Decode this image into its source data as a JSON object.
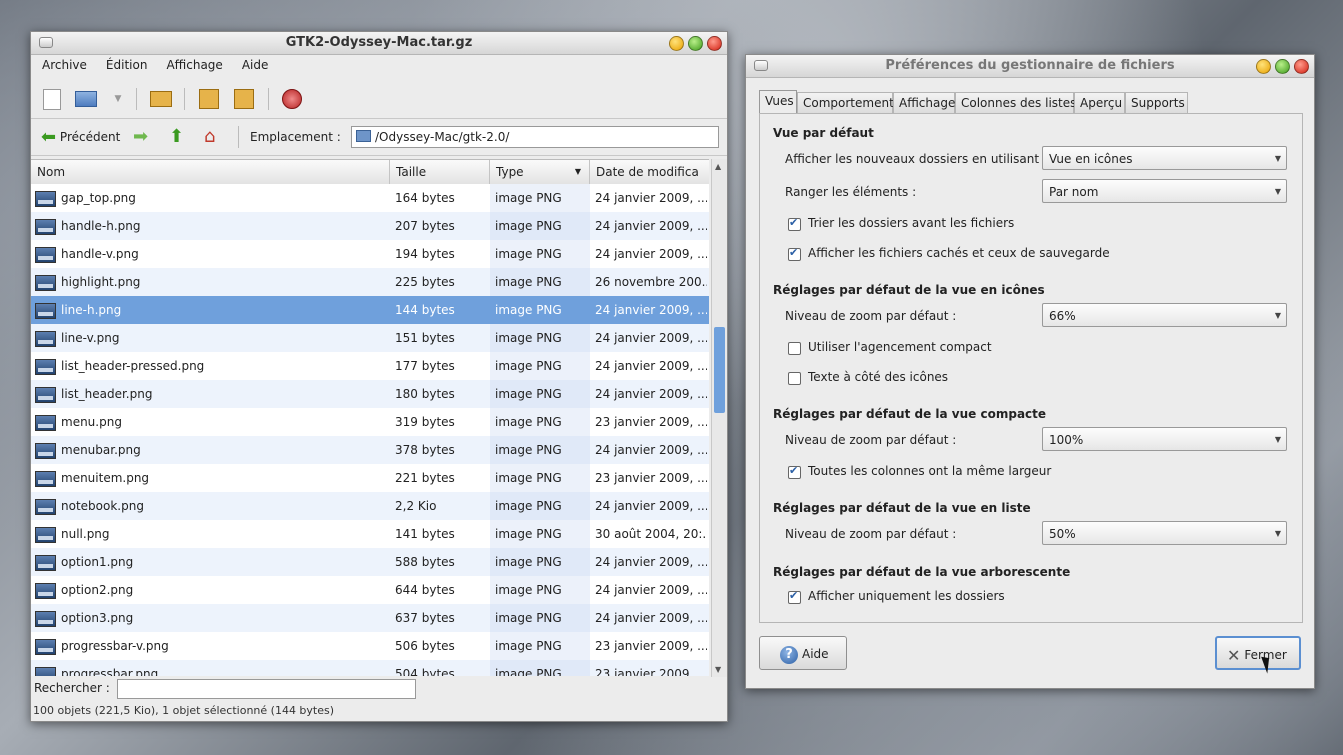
{
  "filemanager": {
    "title": "GTK2-Odyssey-Mac.tar.gz",
    "menu": [
      "Archive",
      "Édition",
      "Affichage",
      "Aide"
    ],
    "nav": {
      "back": "Précédent",
      "location_label": "Emplacement :",
      "location_value": "/Odyssey-Mac/gtk-2.0/"
    },
    "columns": [
      "Nom",
      "Taille",
      "Type",
      "Date de modifica"
    ],
    "files": [
      {
        "name": "gap_top.png",
        "size": "164 bytes",
        "type": "image PNG",
        "date": "24 janvier 2009, ..."
      },
      {
        "name": "handle-h.png",
        "size": "207 bytes",
        "type": "image PNG",
        "date": "24 janvier 2009, ..."
      },
      {
        "name": "handle-v.png",
        "size": "194 bytes",
        "type": "image PNG",
        "date": "24 janvier 2009, ..."
      },
      {
        "name": "highlight.png",
        "size": "225 bytes",
        "type": "image PNG",
        "date": "26 novembre 200..."
      },
      {
        "name": "line-h.png",
        "size": "144 bytes",
        "type": "image PNG",
        "date": "24 janvier 2009, ...",
        "selected": true
      },
      {
        "name": "line-v.png",
        "size": "151 bytes",
        "type": "image PNG",
        "date": "24 janvier 2009, ..."
      },
      {
        "name": "list_header-pressed.png",
        "size": "177 bytes",
        "type": "image PNG",
        "date": "24 janvier 2009, ..."
      },
      {
        "name": "list_header.png",
        "size": "180 bytes",
        "type": "image PNG",
        "date": "24 janvier 2009, ..."
      },
      {
        "name": "menu.png",
        "size": "319 bytes",
        "type": "image PNG",
        "date": "23 janvier 2009, ..."
      },
      {
        "name": "menubar.png",
        "size": "378 bytes",
        "type": "image PNG",
        "date": "24 janvier 2009, ..."
      },
      {
        "name": "menuitem.png",
        "size": "221 bytes",
        "type": "image PNG",
        "date": "23 janvier 2009, ..."
      },
      {
        "name": "notebook.png",
        "size": "2,2 Kio",
        "type": "image PNG",
        "date": "24 janvier 2009, ..."
      },
      {
        "name": "null.png",
        "size": "141 bytes",
        "type": "image PNG",
        "date": "30 août 2004, 20:..."
      },
      {
        "name": "option1.png",
        "size": "588 bytes",
        "type": "image PNG",
        "date": "24 janvier 2009, ..."
      },
      {
        "name": "option2.png",
        "size": "644 bytes",
        "type": "image PNG",
        "date": "24 janvier 2009, ..."
      },
      {
        "name": "option3.png",
        "size": "637 bytes",
        "type": "image PNG",
        "date": "24 janvier 2009, ..."
      },
      {
        "name": "progressbar-v.png",
        "size": "506 bytes",
        "type": "image PNG",
        "date": "23 janvier 2009, ..."
      },
      {
        "name": "progressbar.png",
        "size": "504 bytes",
        "type": "image PNG",
        "date": "23 janvier 2009, ..."
      }
    ],
    "search_label": "Rechercher :",
    "status": "100 objets (221,5 Kio), 1 objet sélectionné (144 bytes)"
  },
  "prefs": {
    "title": "Préférences du gestionnaire de fichiers",
    "tabs": [
      "Vues",
      "Comportement",
      "Affichage",
      "Colonnes des listes",
      "Aperçu",
      "Supports"
    ],
    "section_default": "Vue par défaut",
    "new_folders_label": "Afficher les nouveaux dossiers en utilisant :",
    "new_folders_value": "Vue en icônes",
    "arrange_label": "Ranger les éléments :",
    "arrange_value": "Par nom",
    "sort_folders_label": "Trier les dossiers avant les fichiers",
    "show_hidden_label": "Afficher les fichiers cachés et ceux de sauvegarde",
    "section_icon": "Réglages par défaut de la vue en icônes",
    "icon_zoom_label": "Niveau de zoom par défaut :",
    "icon_zoom_value": "66%",
    "compact_layout_label": "Utiliser l'agencement compact",
    "text_beside_label": "Texte à côté des icônes",
    "section_compact": "Réglages par défaut de la vue compacte",
    "compact_zoom_label": "Niveau de zoom par défaut :",
    "compact_zoom_value": "100%",
    "same_width_label": "Toutes les colonnes ont la même largeur",
    "section_list": "Réglages par défaut de la vue en liste",
    "list_zoom_label": "Niveau de zoom par défaut :",
    "list_zoom_value": "50%",
    "section_tree": "Réglages par défaut de la vue arborescente",
    "only_folders_label": "Afficher uniquement les dossiers",
    "help_button": "Aide",
    "close_button": "Fermer"
  }
}
